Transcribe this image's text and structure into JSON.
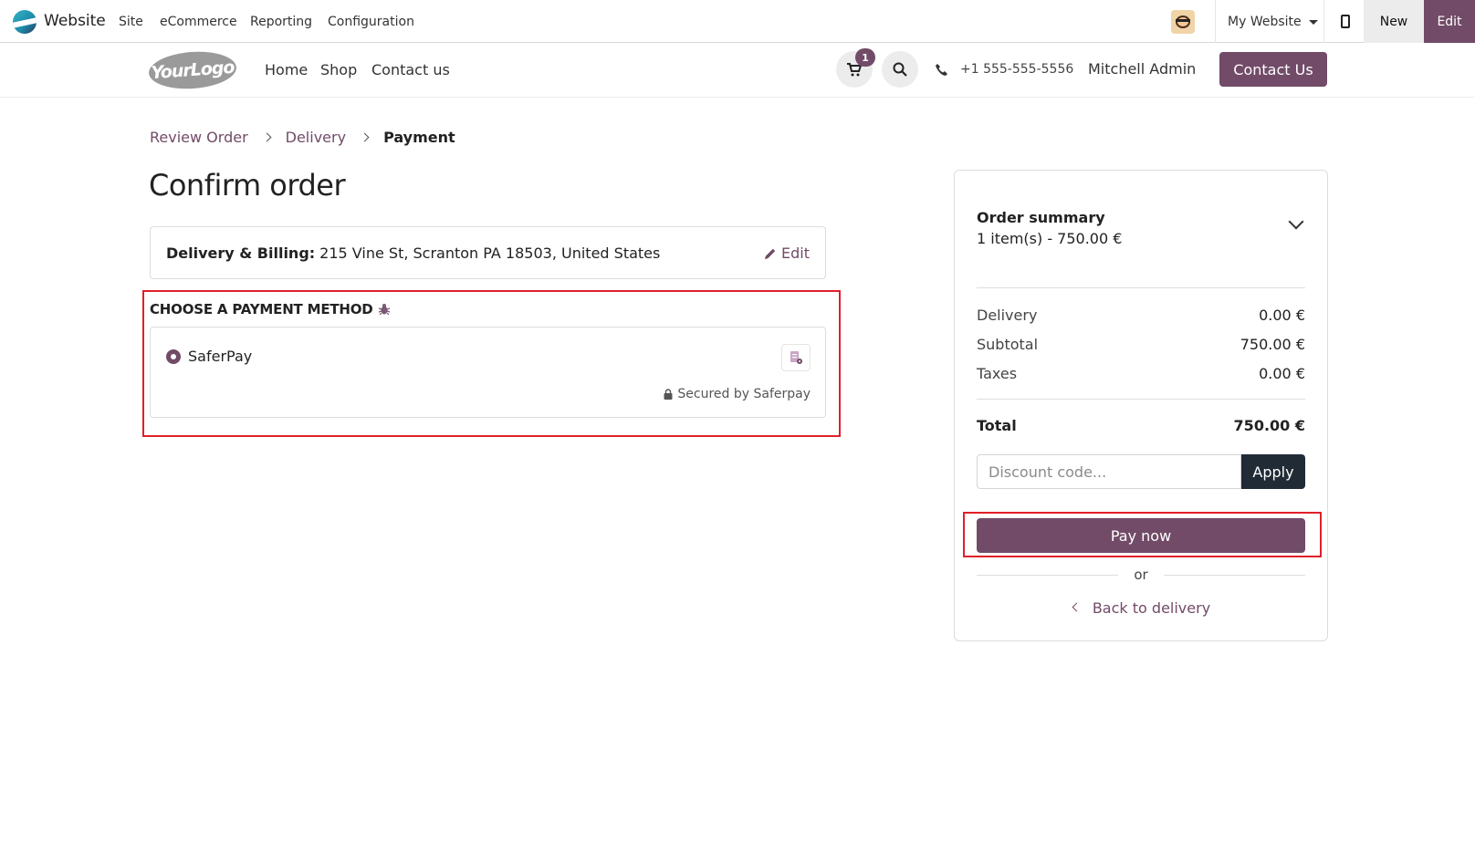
{
  "admin_bar": {
    "app_title": "Website",
    "menu": [
      "Site",
      "eCommerce",
      "Reporting",
      "Configuration"
    ],
    "site_selector": "My Website",
    "new_label": "New",
    "edit_label": "Edit"
  },
  "header": {
    "logo_text": "YourLogo",
    "nav": [
      "Home",
      "Shop",
      "Contact us"
    ],
    "cart_count": "1",
    "phone": "+1 555-555-5556",
    "user": "Mitchell Admin",
    "contact_button": "Contact Us"
  },
  "breadcrumb": {
    "steps": [
      "Review Order",
      "Delivery"
    ],
    "current": "Payment"
  },
  "page_title": "Confirm order",
  "address": {
    "label": "Delivery & Billing:",
    "value": "215 Vine St, Scranton PA 18503, United States",
    "edit_label": "Edit"
  },
  "payment": {
    "title": "CHOOSE A PAYMENT METHOD",
    "method_name": "SaferPay",
    "secured_text": "Secured by Saferpay"
  },
  "summary": {
    "title": "Order summary",
    "item_count": "1 item(s) -  750.00 €",
    "rows": [
      {
        "label": "Delivery",
        "value": "0.00 €"
      },
      {
        "label": "Subtotal",
        "value": "750.00 €"
      },
      {
        "label": "Taxes",
        "value": "0.00 €"
      }
    ],
    "total_label": "Total",
    "total_value": "750.00 €",
    "discount_placeholder": "Discount code...",
    "apply_label": "Apply",
    "pay_label": "Pay now",
    "or_label": "or",
    "back_label": "Back to delivery"
  },
  "colors": {
    "brand": "#714b67",
    "highlight": "#e0202a",
    "dark_button": "#212b35"
  }
}
